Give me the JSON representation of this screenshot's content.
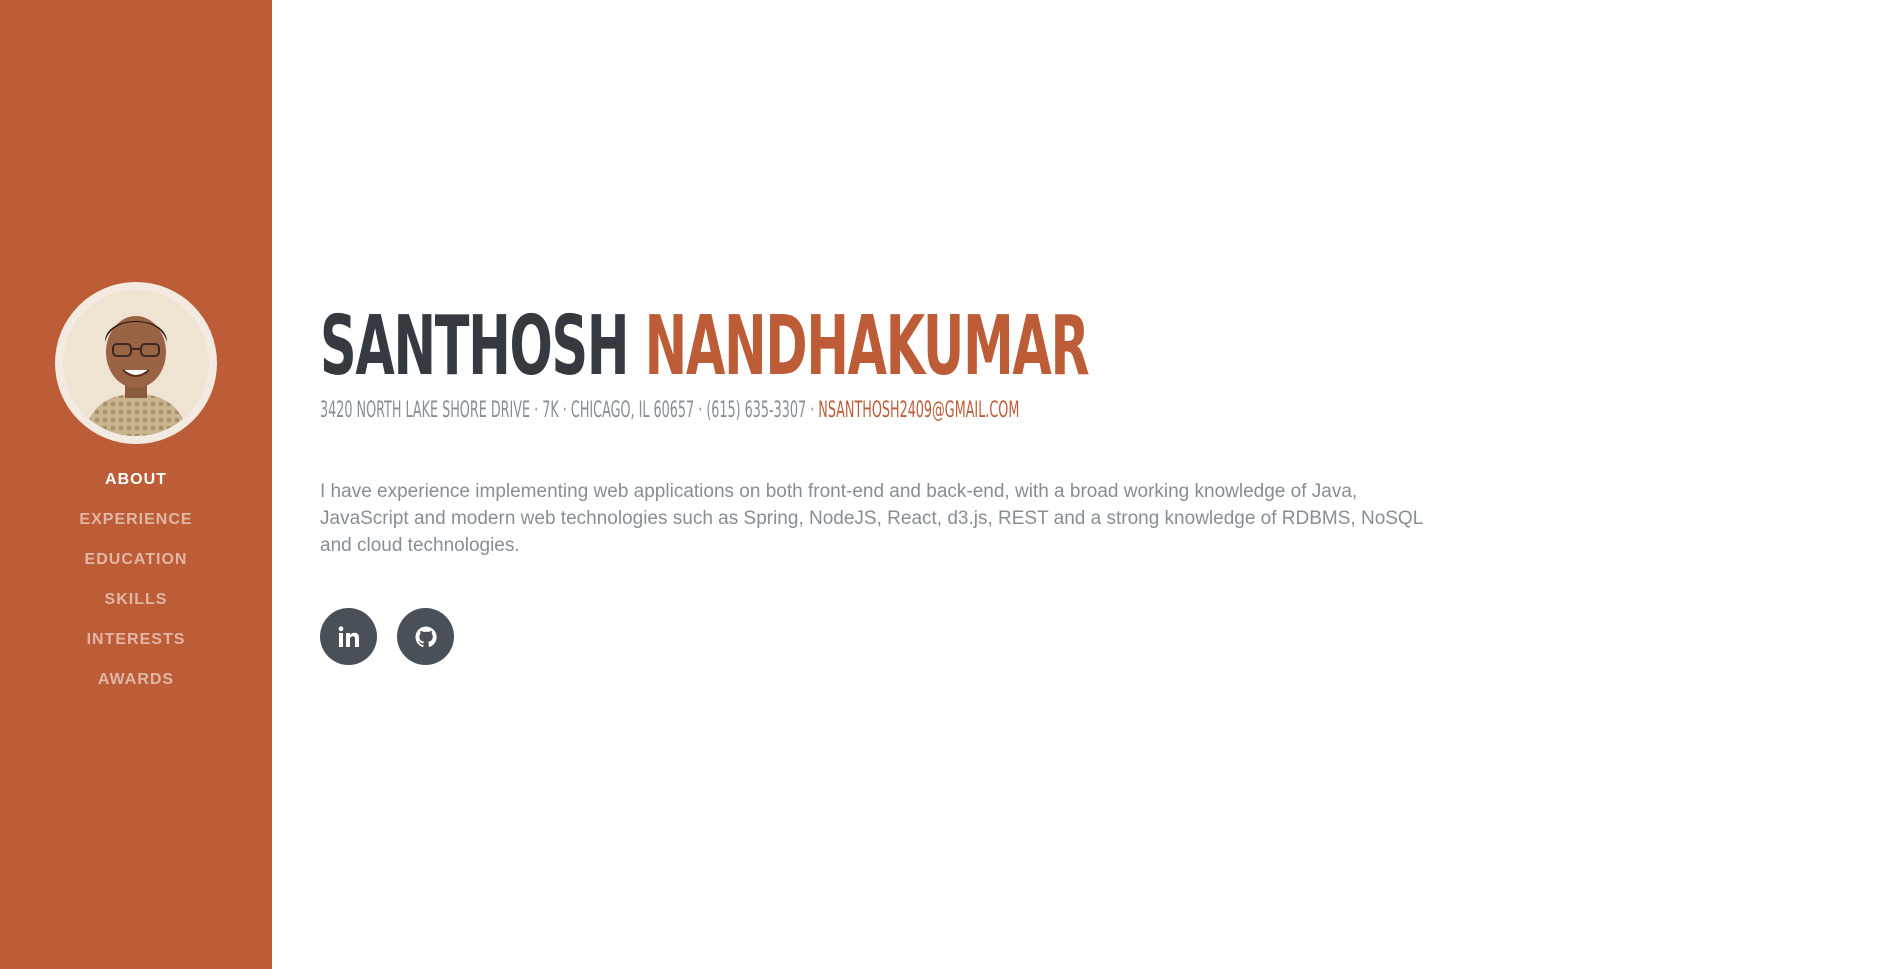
{
  "sidebar": {
    "profile_image": "profile-photo",
    "nav_items": [
      {
        "label": "About",
        "active": true
      },
      {
        "label": "Experience",
        "active": false
      },
      {
        "label": "Education",
        "active": false
      },
      {
        "label": "Skills",
        "active": false
      },
      {
        "label": "Interests",
        "active": false
      },
      {
        "label": "Awards",
        "active": false
      }
    ]
  },
  "about": {
    "first_name": "SANTHOSH",
    "last_name": "NANDHAKUMAR",
    "address": "3420 North Lake Shore Drive · 7K · Chicago, IL 60657 · (615) 635-3307 ·",
    "email": "nsanthosh2409@gmail.com",
    "bio": "I have experience implementing web applications on both front-end and back-end, with a broad working knowledge of Java, JavaScript and modern web technologies such as Spring, NodeJS, React, d3.js, REST and a strong knowledge of RDBMS, NoSQL and cloud technologies.",
    "social": [
      {
        "icon": "linkedin-icon"
      },
      {
        "icon": "github-icon"
      }
    ]
  },
  "colors": {
    "primary": "#bd5d38",
    "dark": "#343a40",
    "muted": "#868e96",
    "social_bg": "#495057"
  }
}
